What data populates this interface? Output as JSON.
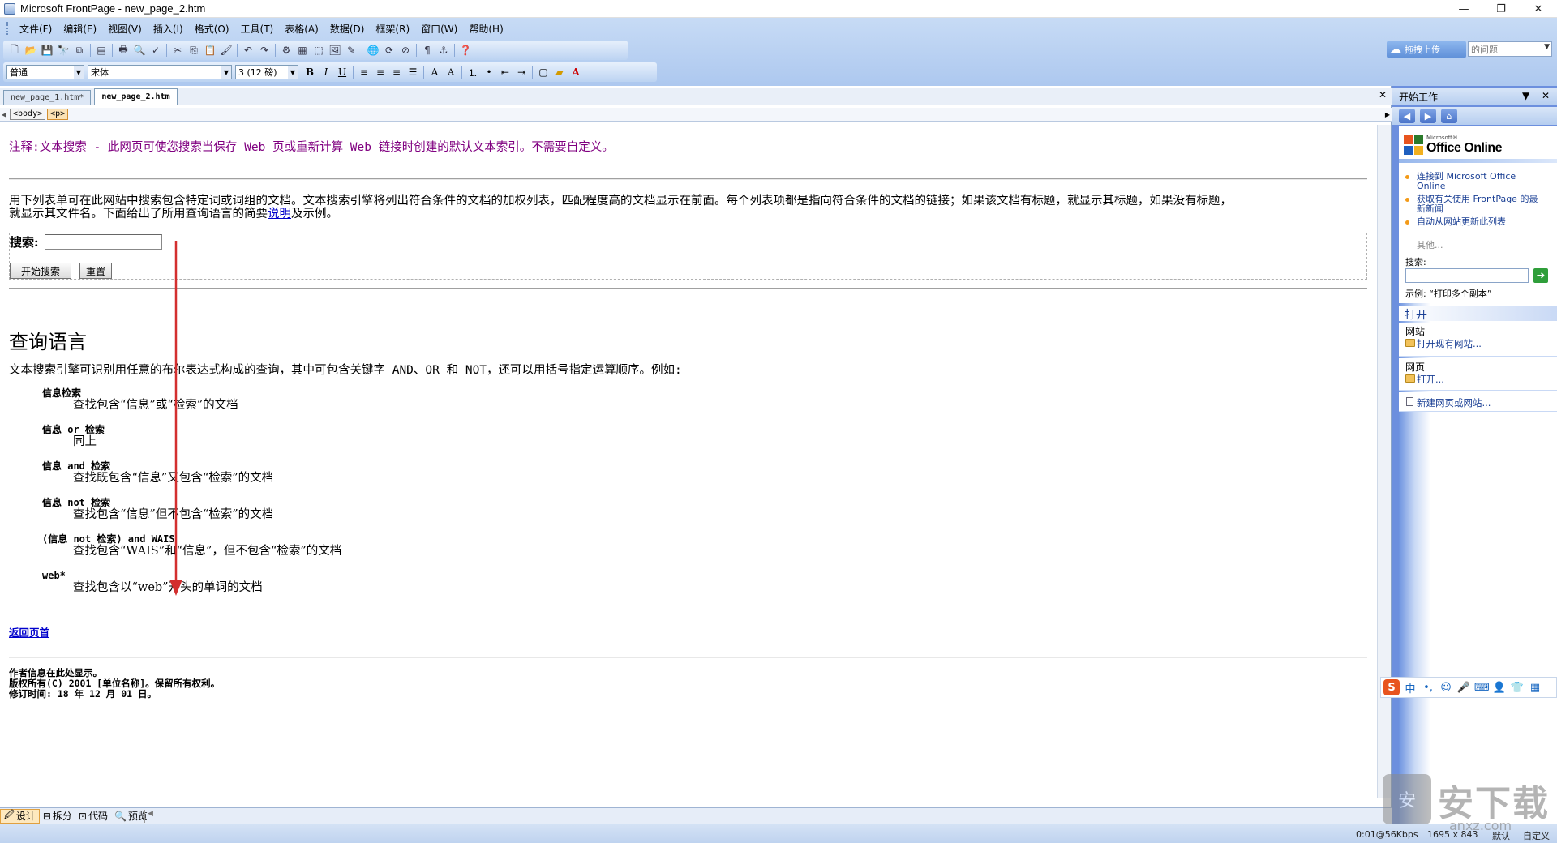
{
  "window": {
    "title": "Microsoft FrontPage - new_page_2.htm",
    "controls": [
      "—",
      "❐",
      "✕"
    ]
  },
  "menubar": {
    "items": [
      "文件(F)",
      "编辑(E)",
      "视图(V)",
      "插入(I)",
      "格式(O)",
      "工具(T)",
      "表格(A)",
      "数据(D)",
      "框架(R)",
      "窗口(W)",
      "帮助(H)"
    ]
  },
  "toolbar": {
    "style_value": "普通",
    "font_value": "宋体",
    "size_value": "3 (12 磅)",
    "upload_label": "拖拽上传",
    "help_placeholder": "的问题"
  },
  "tabs": [
    {
      "label": "new_page_1.htm*",
      "active": false
    },
    {
      "label": "new_page_2.htm",
      "active": true
    }
  ],
  "tagbar": {
    "tags": [
      "<body>",
      "<p>"
    ]
  },
  "document": {
    "note": "注释:文本搜索 - 此网页可使您搜索当保存 Web 页或重新计算 Web 链接时创建的默认文本索引。不需要自定义。",
    "intro_1": "用下列表单可在此网站中搜索包含特定词或词组的文档。文本搜索引擎将列出符合条件的文档的加权列表，匹配程度高的文档显示在前面。每个列表项都是指向符合条件的文档的链接；如果该文档有标题，就显示其标题，如果没有标题，",
    "intro_2a": "就显示其文件名。下面给出了所用查询语言的简要",
    "intro_link": "说明",
    "intro_2b": "及示例。",
    "search_label": "搜索:",
    "search_value": "",
    "start_button": "开始搜索",
    "reset_button": "重置",
    "heading": "查询语言",
    "lang_desc": "文本搜索引擎可识别用任意的布尔表达式构成的查询，其中可包含关键字 AND、OR 和 NOT，还可以用括号指定运算顺序。例如:",
    "examples": [
      {
        "term": "信息检索",
        "desc": "查找包含“信息”或“检索”的文档"
      },
      {
        "term": "信息 or 检索",
        "desc": "同上"
      },
      {
        "term": "信息 and 检索",
        "desc": "查找既包含“信息”又包含“检索”的文档"
      },
      {
        "term": "信息 not 检索",
        "desc": "查找包含“信息”但不包含“检索”的文档"
      },
      {
        "term": "(信息 not 检索) and WAIS",
        "desc": "查找包含“WAIS”和“信息”，但不包含“检索”的文档"
      },
      {
        "term": "web*",
        "desc": "查找包含以“web”开头的单词的文档"
      }
    ],
    "back_link": "返回页首",
    "footer": [
      "作者信息在此处显示。",
      "版权所有(C) 2001 [单位名称]。保留所有权利。",
      "修订时间: 18 年 12 月 01 日。"
    ]
  },
  "viewbar": {
    "views": [
      "设计",
      "拆分",
      "代码",
      "预览"
    ]
  },
  "statusbar": {
    "speed": "0:01@56Kbps",
    "dimensions": "1695 x 843",
    "mode": "默认",
    "custom": "自定义"
  },
  "taskpane": {
    "title": "开始工作",
    "office_ms": "Microsoft®",
    "office_name": "Office Online",
    "links": [
      "连接到 Microsoft Office Online",
      "获取有关使用 FrontPage 的最新新闻",
      "自动从网站更新此列表"
    ],
    "other": "其他...",
    "search_label": "搜索:",
    "example": "示例: “打印多个副本”",
    "open_title": "打开",
    "website_label": "网站",
    "open_website": "打开现有网站...",
    "page_label": "网页",
    "open_page": "打开...",
    "new_link": "新建网页或网站..."
  },
  "ime": {
    "items": [
      "中",
      "•,",
      "☺",
      "🎤",
      "⌨",
      "👤",
      "👕",
      "▦"
    ]
  },
  "watermark": {
    "text": "安下载",
    "domain": "anxz.com"
  },
  "colors": {
    "accent": "#6c8fde",
    "note": "#800080",
    "link": "#0000cc",
    "arrow": "#d32f2f"
  }
}
